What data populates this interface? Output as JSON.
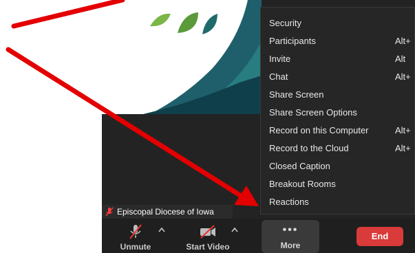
{
  "participant": {
    "name": "Episcopal Diocese of Iowa"
  },
  "toolbar": {
    "unmute_label": "Unmute",
    "start_video_label": "Start Video",
    "more_label": "More",
    "more_dots": "•••",
    "end_label": "End"
  },
  "menu": {
    "items": [
      {
        "label": "Security",
        "shortcut": ""
      },
      {
        "label": "Participants",
        "shortcut": "Alt+"
      },
      {
        "label": "Invite",
        "shortcut": "Alt"
      },
      {
        "label": "Chat",
        "shortcut": "Alt+"
      },
      {
        "label": "Share Screen",
        "shortcut": ""
      },
      {
        "label": "Share Screen Options",
        "shortcut": ""
      },
      {
        "label": "Record on this Computer",
        "shortcut": "Alt+"
      },
      {
        "label": "Record to the Cloud",
        "shortcut": "Alt+"
      },
      {
        "label": "Closed Caption",
        "shortcut": ""
      },
      {
        "label": "Breakout Rooms",
        "shortcut": ""
      },
      {
        "label": "Reactions",
        "shortcut": ""
      }
    ]
  },
  "icons": {
    "muted_mic": "mic-off-icon",
    "video_off": "video-off-icon",
    "more": "more-dots-icon",
    "caret": "caret-up-icon"
  },
  "colors": {
    "end_red": "#d93a3a",
    "arrow_red": "#e30000",
    "menu_bg": "#262626",
    "toolbar_bg": "#1f1f1f",
    "logo_green": "#7ab648",
    "logo_teal": "#1f6b6b"
  }
}
